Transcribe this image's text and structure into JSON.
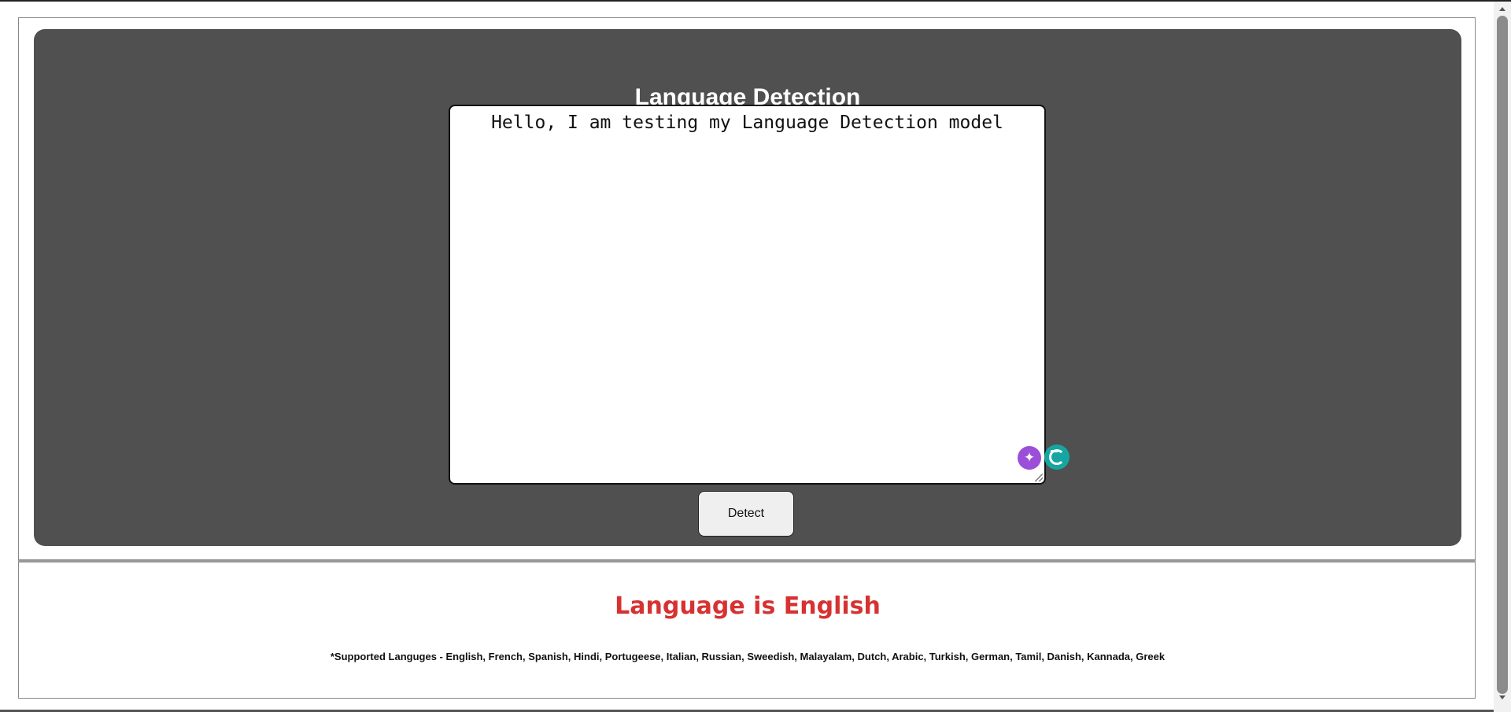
{
  "header": {
    "title": "Language Detection"
  },
  "input": {
    "value": "Hello, I am testing my Language Detection model"
  },
  "icons": {
    "ai_assist": "sparkle-icon",
    "grammarly": "grammarly-g-icon"
  },
  "actions": {
    "detect_label": "Detect"
  },
  "result": {
    "text": "Language is English",
    "supported": "*Supported Languges - English, French, Spanish, Hindi, Portugeese, Italian, Russian, Sweedish, Malayalam, Dutch, Arabic, Turkish, German, Tamil, Danish, Kannada, Greek"
  },
  "colors": {
    "panel_bg": "#505050",
    "result_text": "#d63232",
    "ai_icon": "#9b4fd8",
    "grammarly_icon": "#15a6a2"
  }
}
